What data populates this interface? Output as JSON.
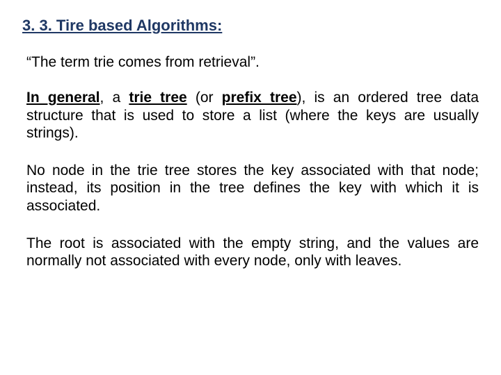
{
  "heading": "3. 3. Tire based Algorithms:",
  "quote": "“The term trie comes from retrieval”.",
  "p1_lead": "In general",
  "p1_sep": ", ",
  "p1_a": "a ",
  "p1_trie": "trie tree",
  "p1_b": " (or ",
  "p1_prefix": "prefix tree",
  "p1_c": "), is an ordered tree data structure that is used to store a list (where the keys are usually strings).",
  "p2": "No node in the trie tree stores the key associated with that node; instead, its position in the tree defines the key with which it is associated.",
  "p3": "The root is associated with the empty string, and the values are normally not associated with every node, only with leaves."
}
